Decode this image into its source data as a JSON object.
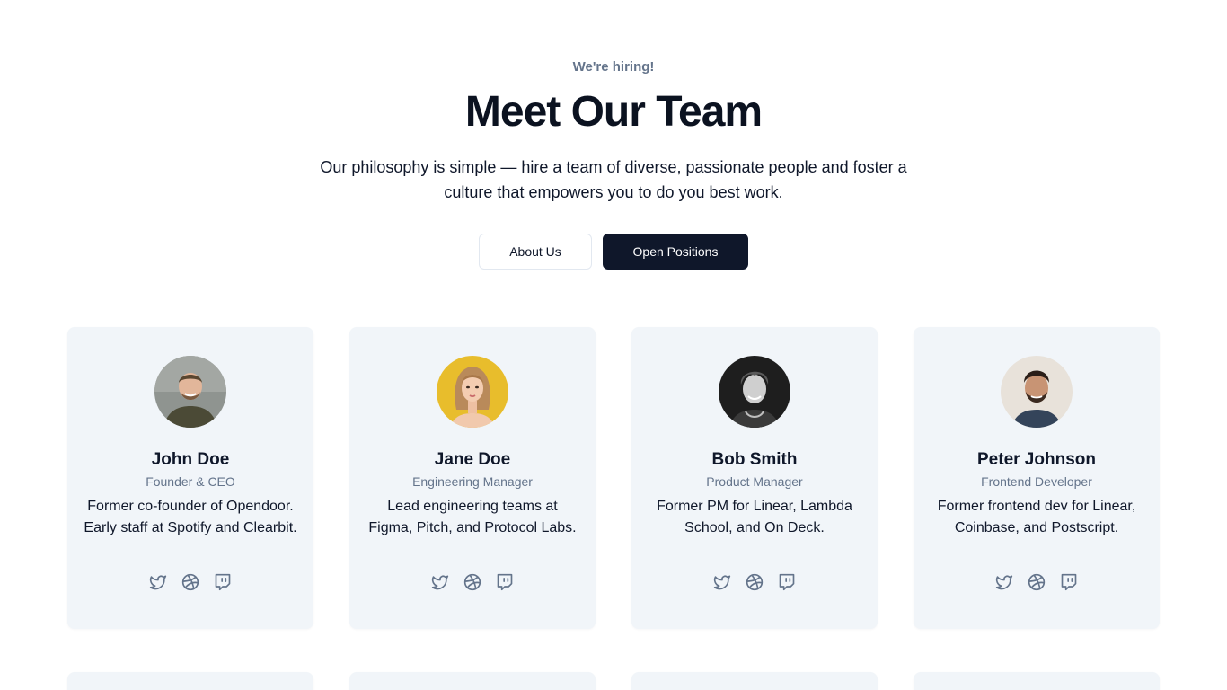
{
  "header": {
    "eyebrow": "We're hiring!",
    "title": "Meet Our Team",
    "subtitle": "Our philosophy is simple — hire a team of diverse, passionate people and foster a culture that empowers you to do you best work."
  },
  "actions": {
    "about_label": "About Us",
    "positions_label": "Open Positions"
  },
  "team": [
    {
      "name": "John Doe",
      "role": "Founder & CEO",
      "bio": "Former co-founder of Opendoor. Early staff at Spotify and Clearbit.",
      "avatar_bg": "#8f9490",
      "socials": [
        "twitter-icon",
        "dribbble-icon",
        "twitch-icon"
      ]
    },
    {
      "name": "Jane Doe",
      "role": "Engineering Manager",
      "bio": "Lead engineering teams at Figma, Pitch, and Protocol Labs.",
      "avatar_bg": "#e8bd2c",
      "socials": [
        "twitter-icon",
        "dribbble-icon",
        "twitch-icon"
      ]
    },
    {
      "name": "Bob Smith",
      "role": "Product Manager",
      "bio": "Former PM for Linear, Lambda School, and On Deck.",
      "avatar_bg": "#1e1e1e",
      "socials": [
        "twitter-icon",
        "dribbble-icon",
        "twitch-icon"
      ]
    },
    {
      "name": "Peter Johnson",
      "role": "Frontend Developer",
      "bio": "Former frontend dev for Linear, Coinbase, and Postscript.",
      "avatar_bg": "#e8e2da",
      "socials": [
        "twitter-icon",
        "dribbble-icon",
        "twitch-icon"
      ]
    }
  ],
  "colors": {
    "card_bg": "#f1f5f9",
    "primary": "#0f172a",
    "muted": "#64748b"
  }
}
